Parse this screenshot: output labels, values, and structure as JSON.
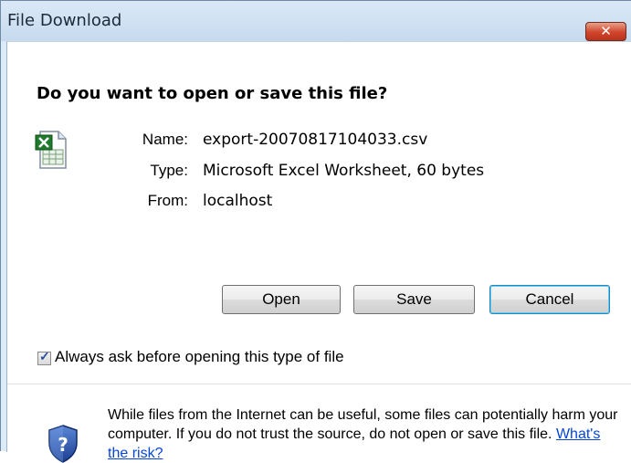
{
  "window": {
    "title": "File Download"
  },
  "dialog": {
    "question": "Do you want to open or save this file?",
    "file": {
      "name_label": "Name:",
      "name_value": "export-20070817104033.csv",
      "type_label": "Type:",
      "type_value": "Microsoft Excel Worksheet, 60 bytes",
      "from_label": "From:",
      "from_value": "localhost",
      "icon": "excel-file-icon"
    },
    "buttons": {
      "open": "Open",
      "save": "Save",
      "cancel": "Cancel"
    },
    "always_ask": {
      "label": "Always ask before opening this type of file",
      "checked": true
    },
    "warning": {
      "icon": "shield-question-icon",
      "text": "While files from the Internet can be useful, some files can potentially harm your computer. If you do not trust the source, do not open or save this file.",
      "link": "What's the risk?"
    }
  },
  "colors": {
    "link": "#0645d8",
    "close_button": "#d1452c",
    "title_bar": "#dbe9f6"
  }
}
